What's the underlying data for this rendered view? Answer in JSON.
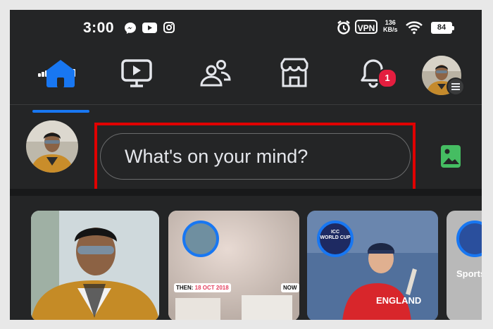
{
  "status_bar": {
    "time": "3:00",
    "vpn_label": "VPN",
    "net_speed_value": "136",
    "net_speed_unit": "KB/s",
    "battery": "84"
  },
  "nav": {
    "items": [
      "home-icon",
      "video-icon",
      "friends-icon",
      "marketplace-icon",
      "notifications-icon",
      "profile-menu"
    ],
    "active": "home",
    "notification_count": "1",
    "accent": "#1877f2",
    "badge_color": "#e41e3f"
  },
  "composer": {
    "placeholder": "What's on your mind?",
    "highlight_color": "#e00000",
    "photo_icon_color": "#45bd62"
  },
  "stories": {
    "items": [
      {
        "kind": "create-story"
      },
      {
        "kind": "memory",
        "then_label": "THEN",
        "then_date": "18 OCT 2018",
        "now_label": "NOW"
      },
      {
        "kind": "story",
        "title_line1": "ICC",
        "title_line2": "WORLD CUP",
        "caption": "ENGLAND"
      },
      {
        "kind": "story",
        "caption": "Sports"
      }
    ]
  }
}
